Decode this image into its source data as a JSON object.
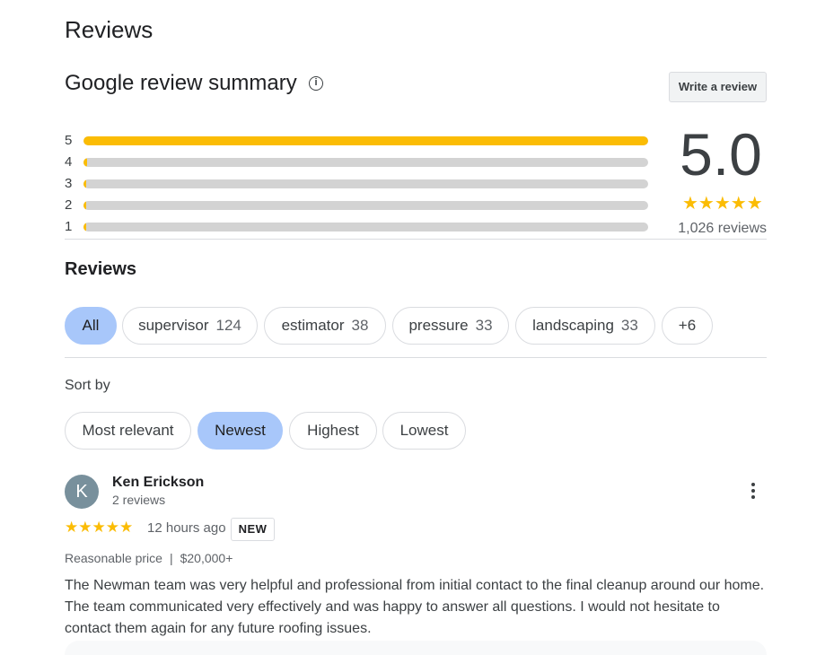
{
  "page": {
    "title": "Reviews"
  },
  "summary": {
    "title": "Google review summary",
    "info_icon": "info-icon",
    "write_review_label": "Write a review",
    "score": "5.0",
    "stars": "★★★★★",
    "review_count": "1,026 reviews",
    "bars": [
      {
        "label": "5",
        "fraction": 1.0
      },
      {
        "label": "4",
        "fraction": 0.006
      },
      {
        "label": "3",
        "fraction": 0.002
      },
      {
        "label": "2",
        "fraction": 0.001
      },
      {
        "label": "1",
        "fraction": 0.001
      }
    ],
    "bar_colors": {
      "fill": "#fbbc04",
      "track": "#d3d3d3"
    }
  },
  "reviews_section": {
    "title": "Reviews",
    "topics": [
      {
        "label": "All",
        "count": "",
        "selected": true
      },
      {
        "label": "supervisor",
        "count": "124",
        "selected": false
      },
      {
        "label": "estimator",
        "count": "38",
        "selected": false
      },
      {
        "label": "pressure",
        "count": "33",
        "selected": false
      },
      {
        "label": "landscaping",
        "count": "33",
        "selected": false
      },
      {
        "label": "+6",
        "count": "",
        "selected": false
      }
    ],
    "sort_label": "Sort by",
    "sort_options": [
      {
        "label": "Most relevant",
        "selected": false
      },
      {
        "label": "Newest",
        "selected": true
      },
      {
        "label": "Highest",
        "selected": false
      },
      {
        "label": "Lowest",
        "selected": false
      }
    ]
  },
  "review": {
    "avatar_letter": "K",
    "avatar_color": "#78909c",
    "name": "Ken Erickson",
    "sub": "2 reviews",
    "more_icon": "more-vert-icon",
    "stars": "★★★★★",
    "rating": 5,
    "time": "12 hours ago",
    "badge": "NEW",
    "price_label": "Reasonable price",
    "price_sep": "|",
    "price_value": "$20,000+",
    "text": "The Newman team was very helpful and professional from initial contact to the final cleanup around our home. The team communicated very effectively and was happy to answer all questions. I would not hesitate to contact them again for any future roofing issues."
  },
  "colors": {
    "accent_selected": "#a8c7fa",
    "star": "#fbbc04"
  }
}
